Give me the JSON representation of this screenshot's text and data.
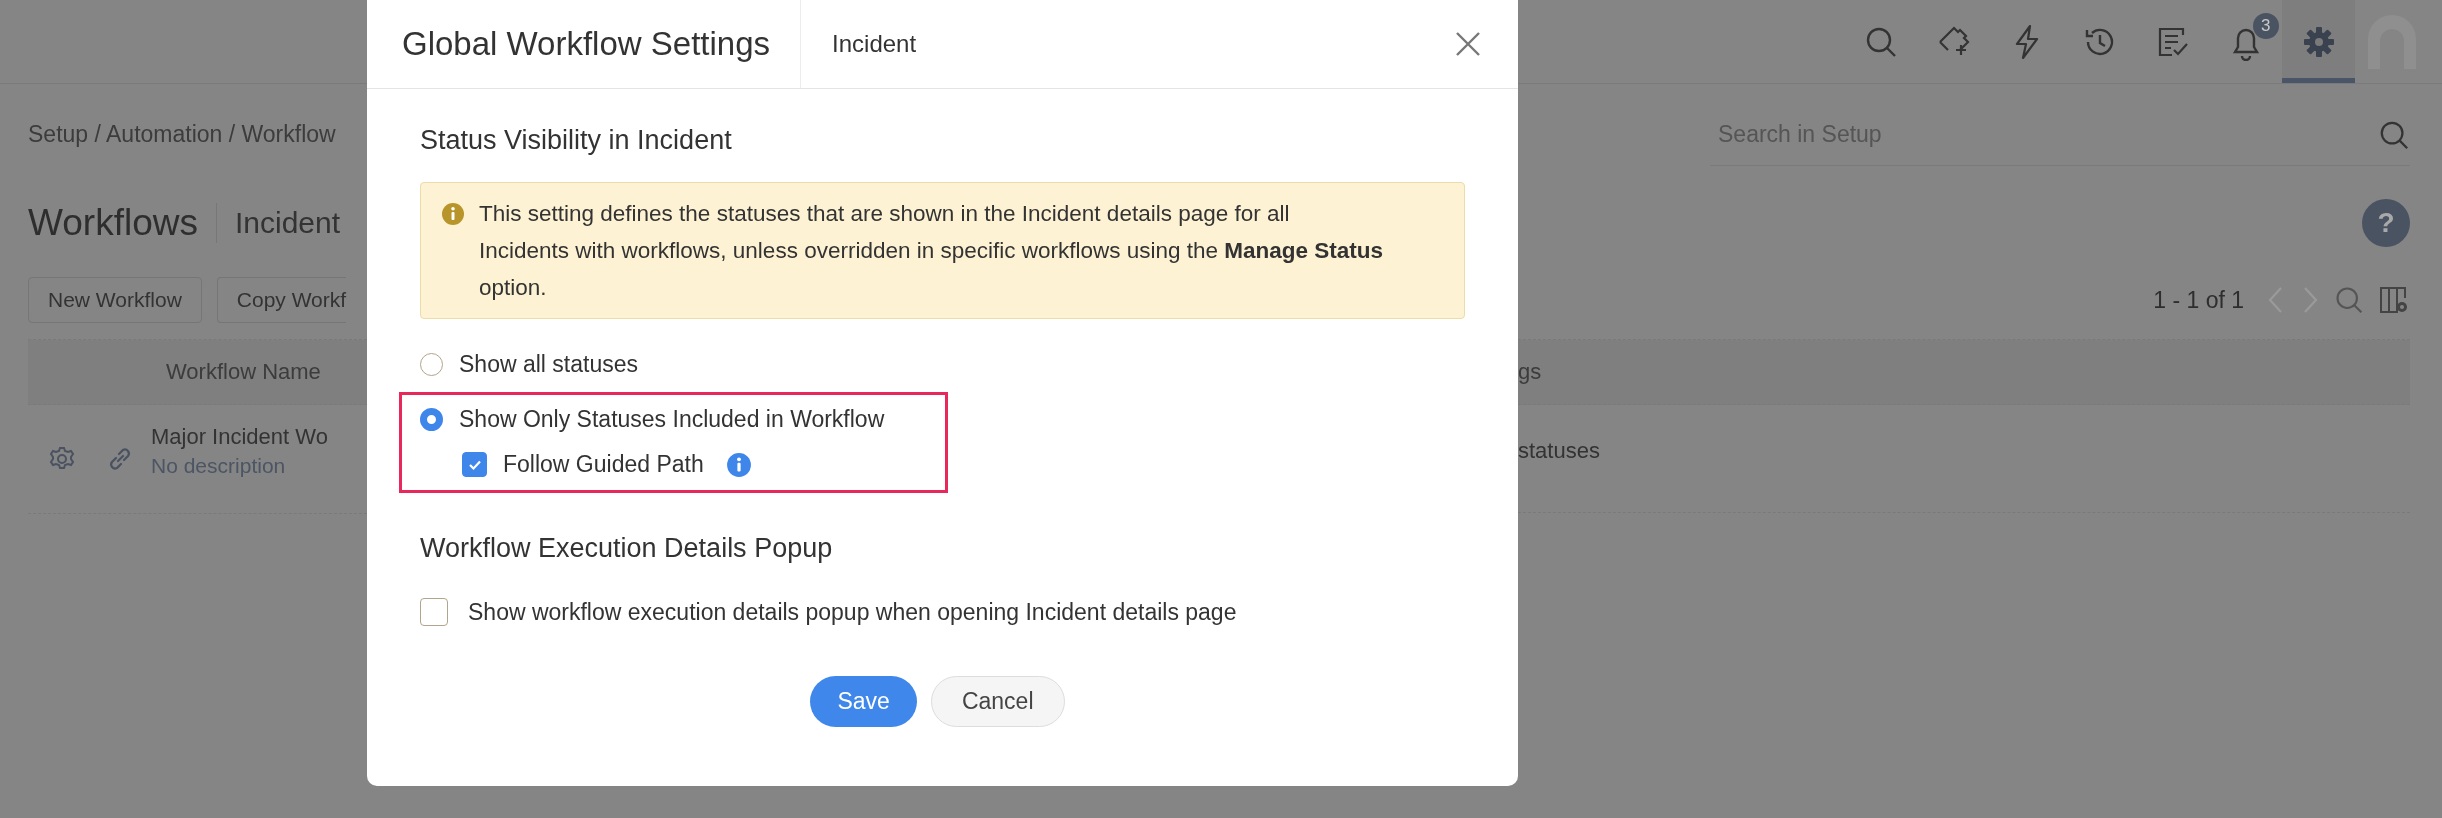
{
  "toolbar": [
    {
      "selected": false
    },
    {
      "selected": false
    },
    {
      "selected": false
    },
    {
      "selected": false
    },
    {
      "selected": false
    },
    {
      "selected": false,
      "badge": "3"
    },
    {
      "selected": true
    },
    {
      "selected": false
    }
  ],
  "breadcrumb": "Setup / Automation / Workflow",
  "page_title": "Workflows",
  "page_subtitle": "Incident",
  "buttons": [
    "New Workflow",
    "Copy Workf"
  ],
  "search": {
    "placeholder": "Search in Setup"
  },
  "help_button": "?",
  "pagination": "1 - 1 of 1",
  "table": {
    "columns": [
      "Workflow Name",
      "gs"
    ],
    "rows": [
      {
        "name": "Major Incident Wo",
        "description": "No description",
        "column_3": "statuses"
      }
    ]
  },
  "modal": {
    "title": "Global Workflow Settings",
    "crumb": "Incident",
    "section_1": "Status Visibility in Incident",
    "notice": "This setting defines the statuses that are shown in the Incident details page for all Incidents with workflows, unless overridden in specific workflows using the **Manage Status** option.",
    "options": [
      {
        "label": "Show all statuses",
        "selected": false
      },
      {
        "label": "Show Only Statuses Included in Workflow",
        "selected": true
      }
    ],
    "guided_path": {
      "label": "Follow Guided Path",
      "checked": true
    },
    "section_2": "Workflow Execution Details Popup",
    "popup_option": {
      "label": "Show workflow execution details popup when opening Incident details page",
      "checked": false
    },
    "buttons": [
      "Save",
      "Cancel"
    ]
  }
}
